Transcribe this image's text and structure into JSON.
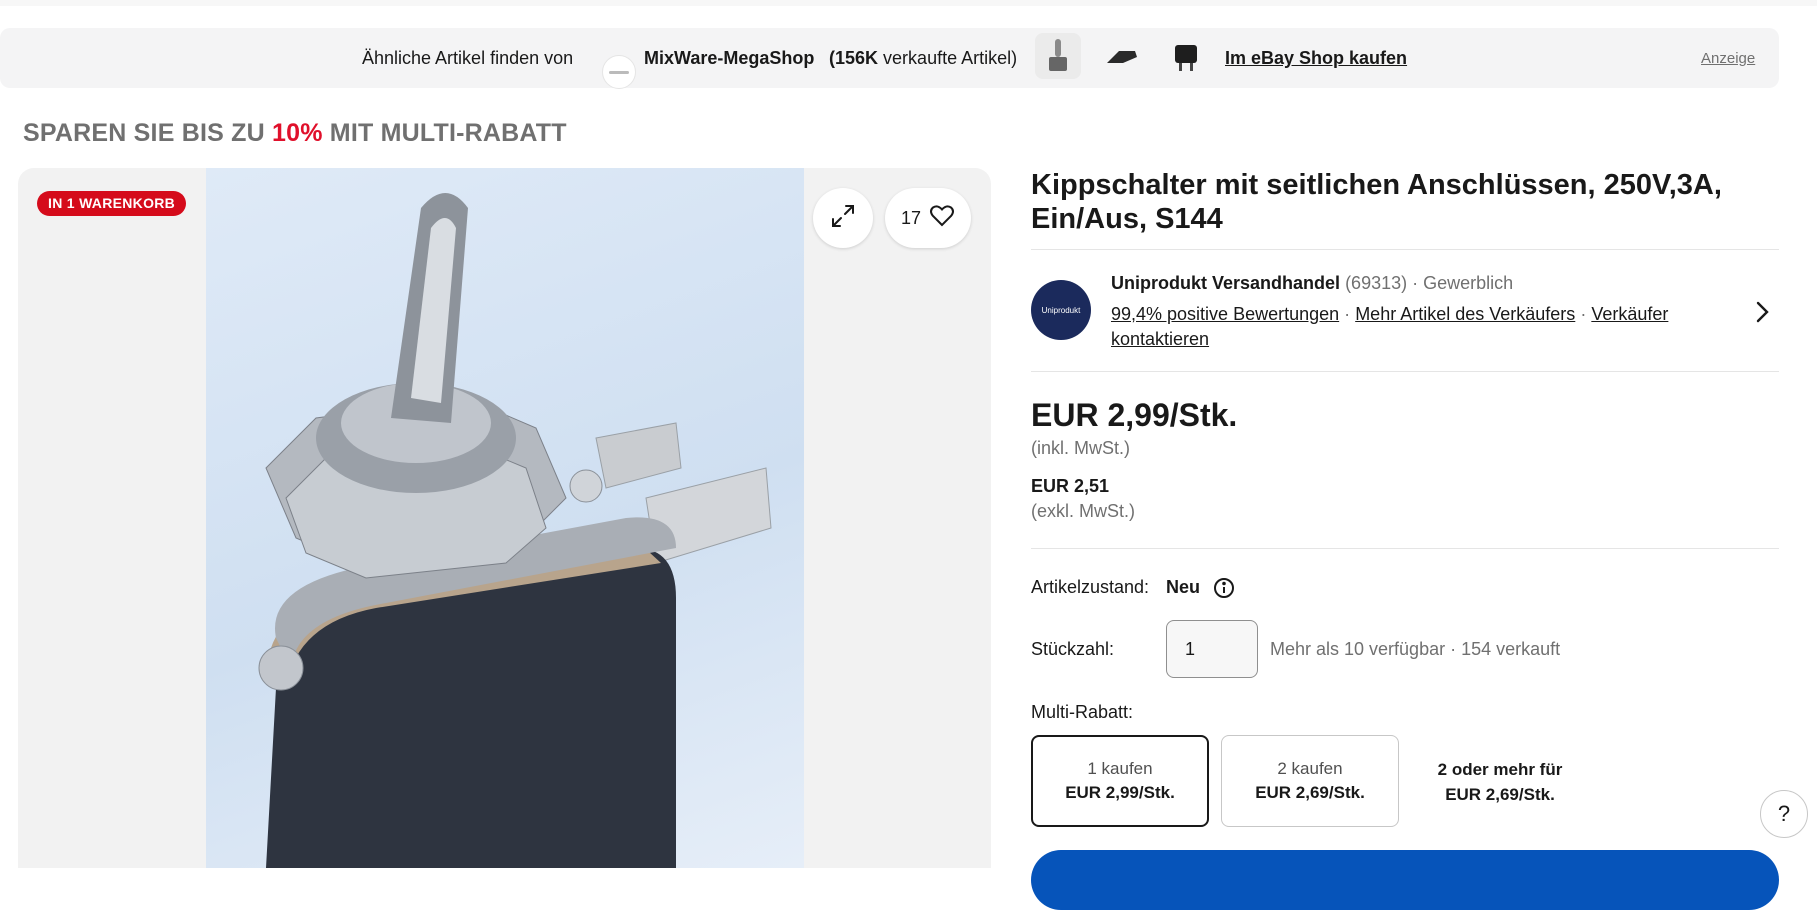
{
  "promo_bar": {
    "label": "Ähnliche Artikel finden von",
    "store_name": "MixWare-MegaShop",
    "sold_count": "(156K",
    "sold_suffix": "verkaufte Artikel)",
    "shop_link": "Im eBay Shop kaufen",
    "ad_label": "Anzeige"
  },
  "multibuy_heading": {
    "part1": "SPAREN SIE BIS ZU ",
    "percent": "10%",
    "part2": " MIT MULTI-RABATT"
  },
  "gallery": {
    "cart_badge": "IN 1 WARENKORB",
    "watch_count": "17"
  },
  "listing": {
    "title": "Kippschalter mit seitlichen Anschlüssen, 250V,3A, Ein/Aus, S144"
  },
  "seller": {
    "logo_text": "Uniprodukt",
    "name": "Uniprodukt Versandhandel",
    "feedback_count": "(69313)",
    "type": "Gewerblich",
    "positive": "99,4% positive Bewertungen",
    "more_items": "Mehr Artikel des Verkäufers",
    "contact": "Verkäufer kontaktieren"
  },
  "pricing": {
    "price": "EUR 2,99/Stk.",
    "price_note": "(inkl. MwSt.)",
    "net_price": "EUR 2,51",
    "net_note": "(exkl. MwSt.)"
  },
  "condition": {
    "label": "Artikelzustand:",
    "value": "Neu"
  },
  "quantity": {
    "label": "Stückzahl:",
    "value": "1",
    "availability": "Mehr als 10 verfügbar · 154 verkauft"
  },
  "multi_rabatt": {
    "label": "Multi-Rabatt:",
    "tiers": [
      {
        "line1": "1 kaufen",
        "line2": "EUR 2,99/Stk."
      },
      {
        "line1": "2 kaufen",
        "line2": "EUR 2,69/Stk."
      }
    ],
    "extra_line1": "2 oder mehr für",
    "extra_line2": "EUR 2,69/Stk."
  },
  "help": {
    "label": "?"
  }
}
